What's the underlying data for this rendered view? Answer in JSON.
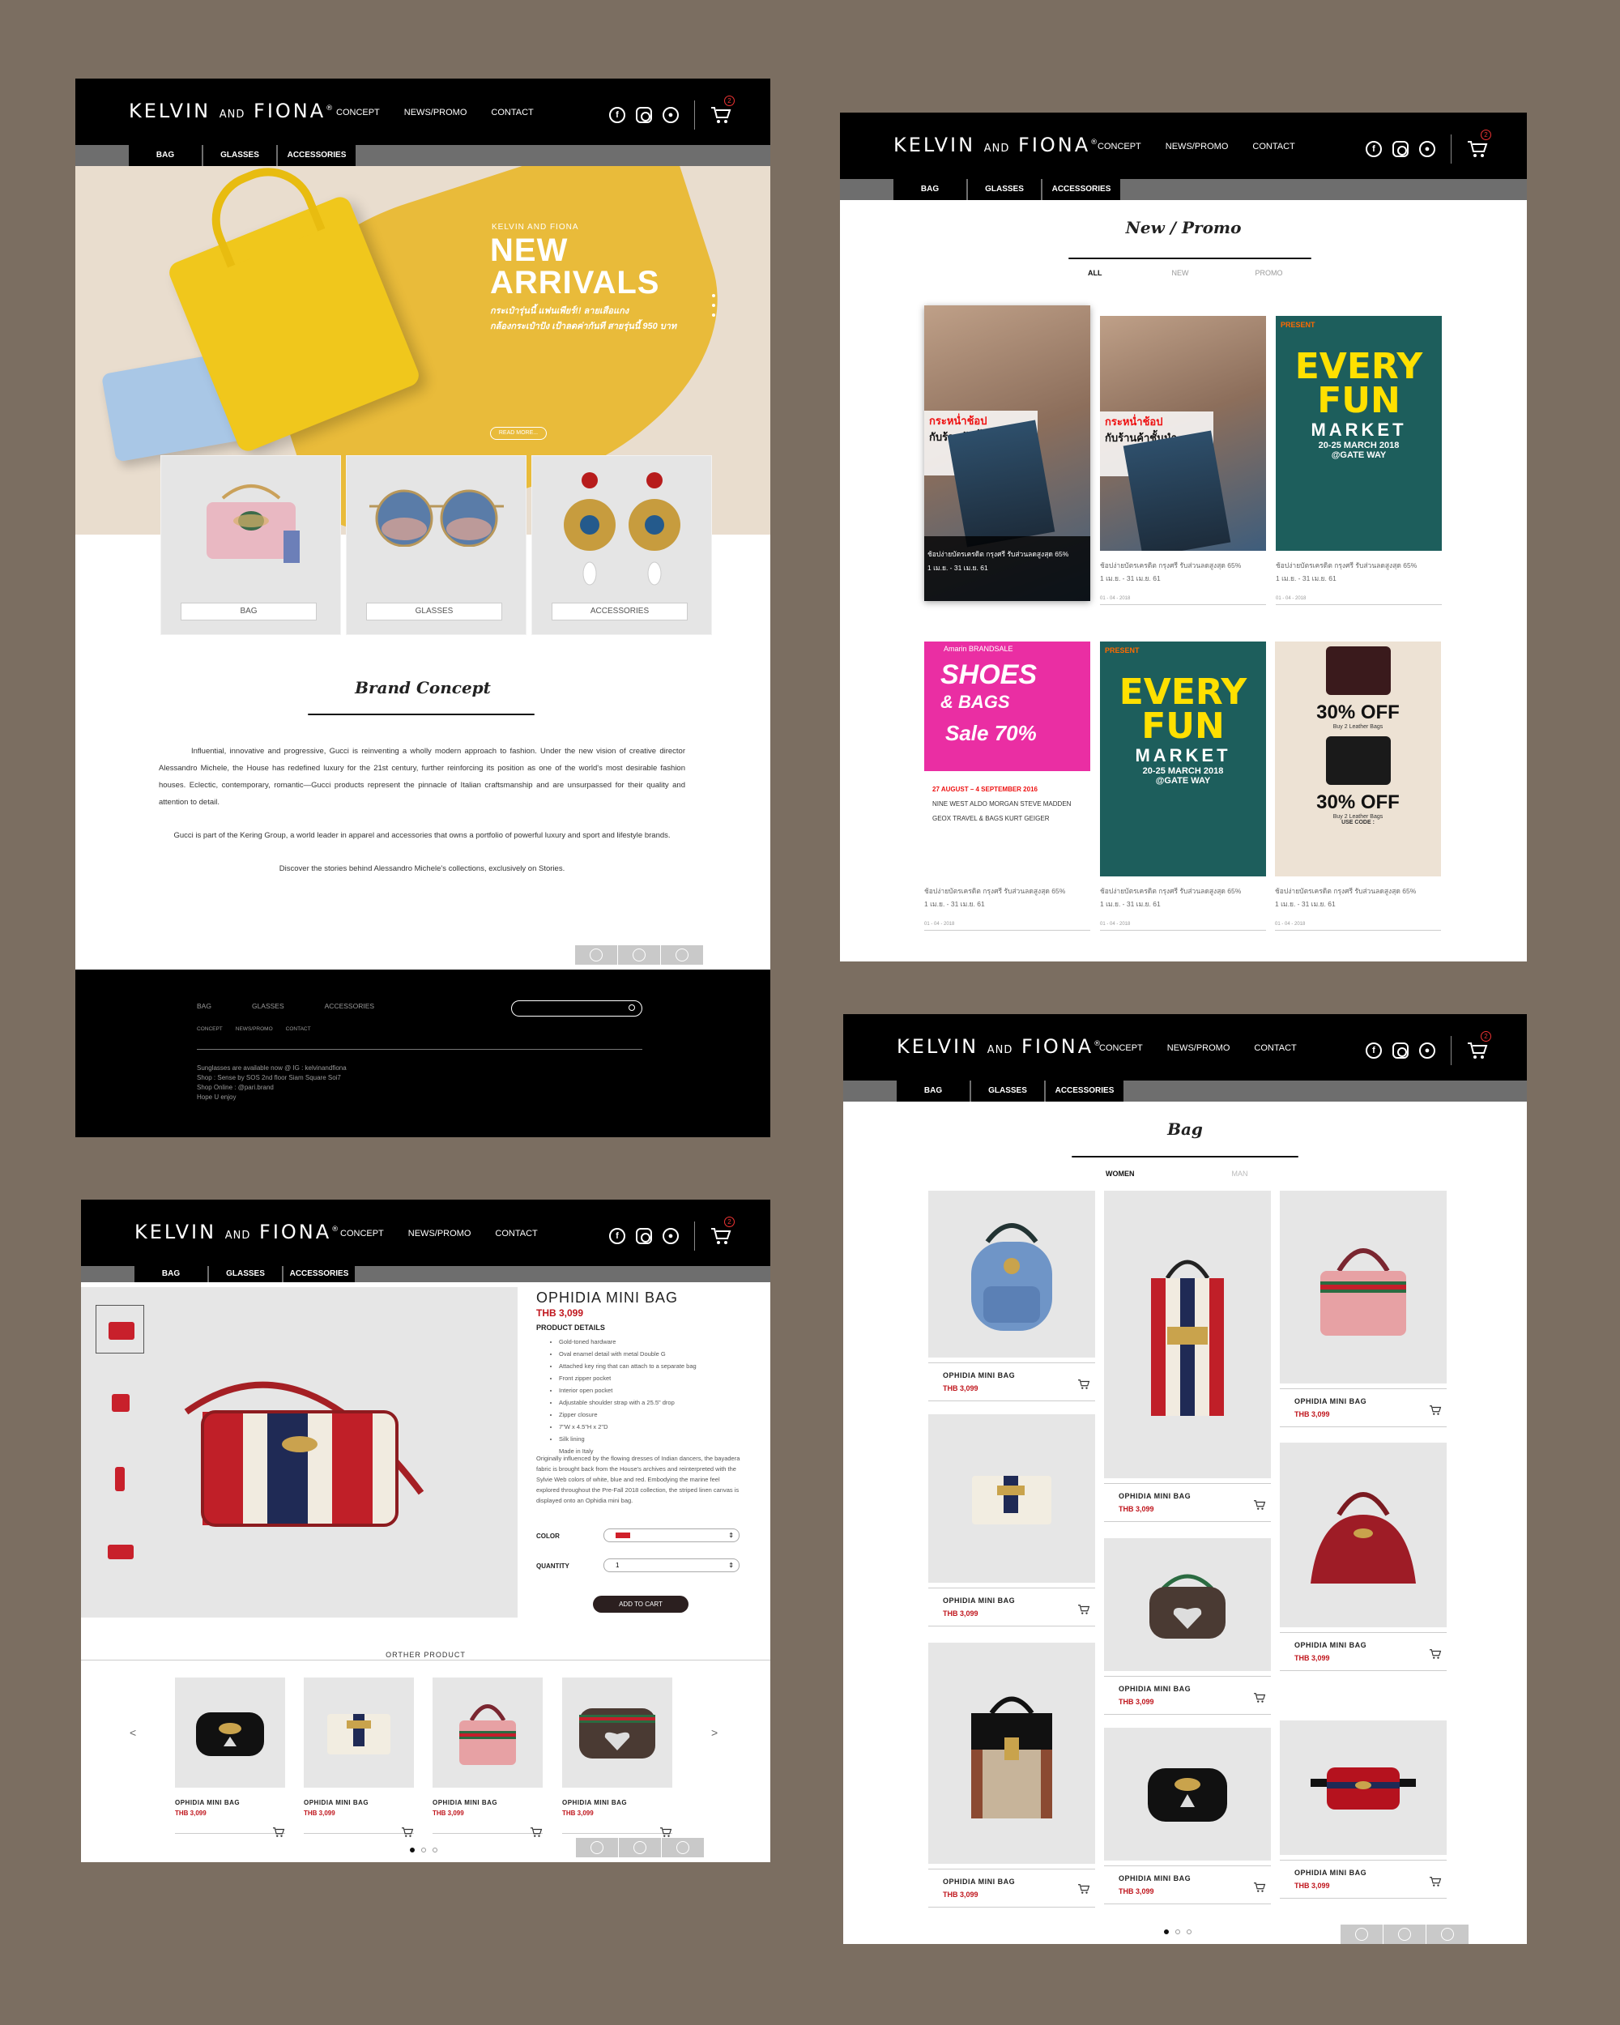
{
  "brand": {
    "name_left": "KELVIN",
    "name_mid": "AND",
    "name_right": "FIONA",
    "reg": "®"
  },
  "nav": {
    "concept": "CONCEPT",
    "news": "NEWS/PROMO",
    "contact": "CONTACT",
    "cart_count": "2"
  },
  "cats": {
    "bag": "BAG",
    "glasses": "GLASSES",
    "accessories": "ACCESSORIES"
  },
  "icons": [
    "facebook-icon",
    "instagram-icon",
    "line-icon",
    "cart-icon",
    "search-icon"
  ],
  "colors": {
    "nav_bg": "#000000",
    "catbar_bg": "#6e6e6e",
    "price_red": "#c0161d",
    "page_bg": "#7b6e61",
    "hero_yellow": "#e9b72a"
  },
  "home": {
    "hero_brand": "KELVIN AND FIONA",
    "hero_line1": "NEW",
    "hero_line2": "ARRIVALS",
    "hero_thai1": "กระเป๋ารุ่นนี้ แฟนเพียร์!! ลายเสือแกง",
    "hero_thai2": "กล้องกระเป๋าปัง เป้าลดค่ากันที สายรุ่นนี้ 950 บาท",
    "read_more": "READ MORE...",
    "card_bag": "BAG",
    "card_glasses": "GLASSES",
    "card_accessories": "ACCESSORIES",
    "concept_title": "Brand Concept",
    "concept_p1": "Influential, innovative and progressive, Gucci is reinventing a wholly modern approach to fashion. Under the new vision of creative director Alessandro Michele, the House has redefined luxury for the 21st century, further reinforcing its position as one of the world's most desirable fashion houses. Eclectic, contemporary, romantic—Gucci products represent the pinnacle of Italian craftsmanship and are unsurpassed for their quality and attention to detail.",
    "concept_p2": "Gucci is part of the Kering Group, a world leader in apparel and accessories that owns a portfolio of powerful luxury and sport and lifestyle brands.",
    "concept_p3": "Discover the stories behind Alessandro Michele's collections, exclusively on Stories.",
    "footer_bag": "BAG",
    "footer_glasses": "GLASSES",
    "footer_accessories": "ACCESSORIES",
    "footer_concept": "CONCEPT",
    "footer_news": "NEWS/PROMO",
    "footer_contact": "CONTACT",
    "footer_info1": "Sunglasses are available now @ IG : kelvinandfiona",
    "footer_info2": "Shop : Sense by SOS 2nd floor Siam Square Soi7",
    "footer_info3": "Shop Online : @pari.brand",
    "footer_info4": "Hope U enjoy"
  },
  "promo": {
    "title": "New / Promo",
    "tab_all": "ALL",
    "tab_new": "NEW",
    "tab_promo": "PROMO",
    "caption": "ช้อปง่ายบัตรเครดิต กรุงศรี รับส่วนลดสูงสุด 65%",
    "range": "1 เม.ย. - 31 เม.ย. 61",
    "date": "01 - 04 - 2018",
    "shop_txt1": "กระหน่ำช้อป",
    "shop_txt2": "กับร้านค้าชั้นนำ",
    "fun_present": "PRESENT",
    "fun_every": "EVERY",
    "fun_fun": "FUN",
    "fun_market": "MARKET",
    "fun_date": "20-25 MARCH 2018",
    "fun_gate": "@GATE WAY",
    "pink_top": "Amarin BRANDSALE",
    "pink_shoes": "SHOES",
    "pink_bags": "& BAGS",
    "pink_sale": "Sale 70%",
    "pink_dates": "27 AUGUST – 4 SEPTEMBER 2016",
    "pink_brands1": "NINE WEST   ALDO   MORGAN   STEVE MADDEN",
    "pink_brands2": "GEOX   TRAVEL & BAGS   KURT GEIGER",
    "off_pct": "30% OFF",
    "off_sub": "Buy 2 Leather Bags",
    "off_code": "USE CODE :"
  },
  "product": {
    "title": "OPHIDIA MINI BAG",
    "price": "THB 3,099",
    "details_h": "PRODUCT DETAILS",
    "details": [
      "Gold-toned hardware",
      "Oval enamel detail with metal Double G",
      "Attached key ring that can attach to a separate bag",
      "Front zipper pocket",
      "Interior open pocket",
      "Adjustable shoulder strap with a 25.5\" drop",
      "Zipper closure",
      "7\"W x 4.5\"H x 2\"D",
      "Silk lining",
      "Made in Italy"
    ],
    "desc": "Originally influenced by the flowing dresses of Indian dancers, the bayadera fabric is brought back from the House's archives and reinterpreted with the Sylvie Web colors of white, blue and red. Embodying the marine feel explored throughout the Pre-Fall 2018 collection, the striped linen canvas is displayed onto an Ophidia mini bag.",
    "color_label": "COLOR",
    "qty_label": "QUANTITY",
    "qty_value": "1",
    "add_to_cart": "ADD TO CART",
    "orther": "ORTHER PRODUCT",
    "prev": "<",
    "next": ">",
    "item_name": "OPHIDIA MINI BAG",
    "item_price": "THB 3,099"
  },
  "bagpage": {
    "title": "Bag",
    "tab_women": "WOMEN",
    "tab_men": "MAN",
    "item_name": "OPHIDIA MINI BAG",
    "item_price": "THB 3,099"
  }
}
